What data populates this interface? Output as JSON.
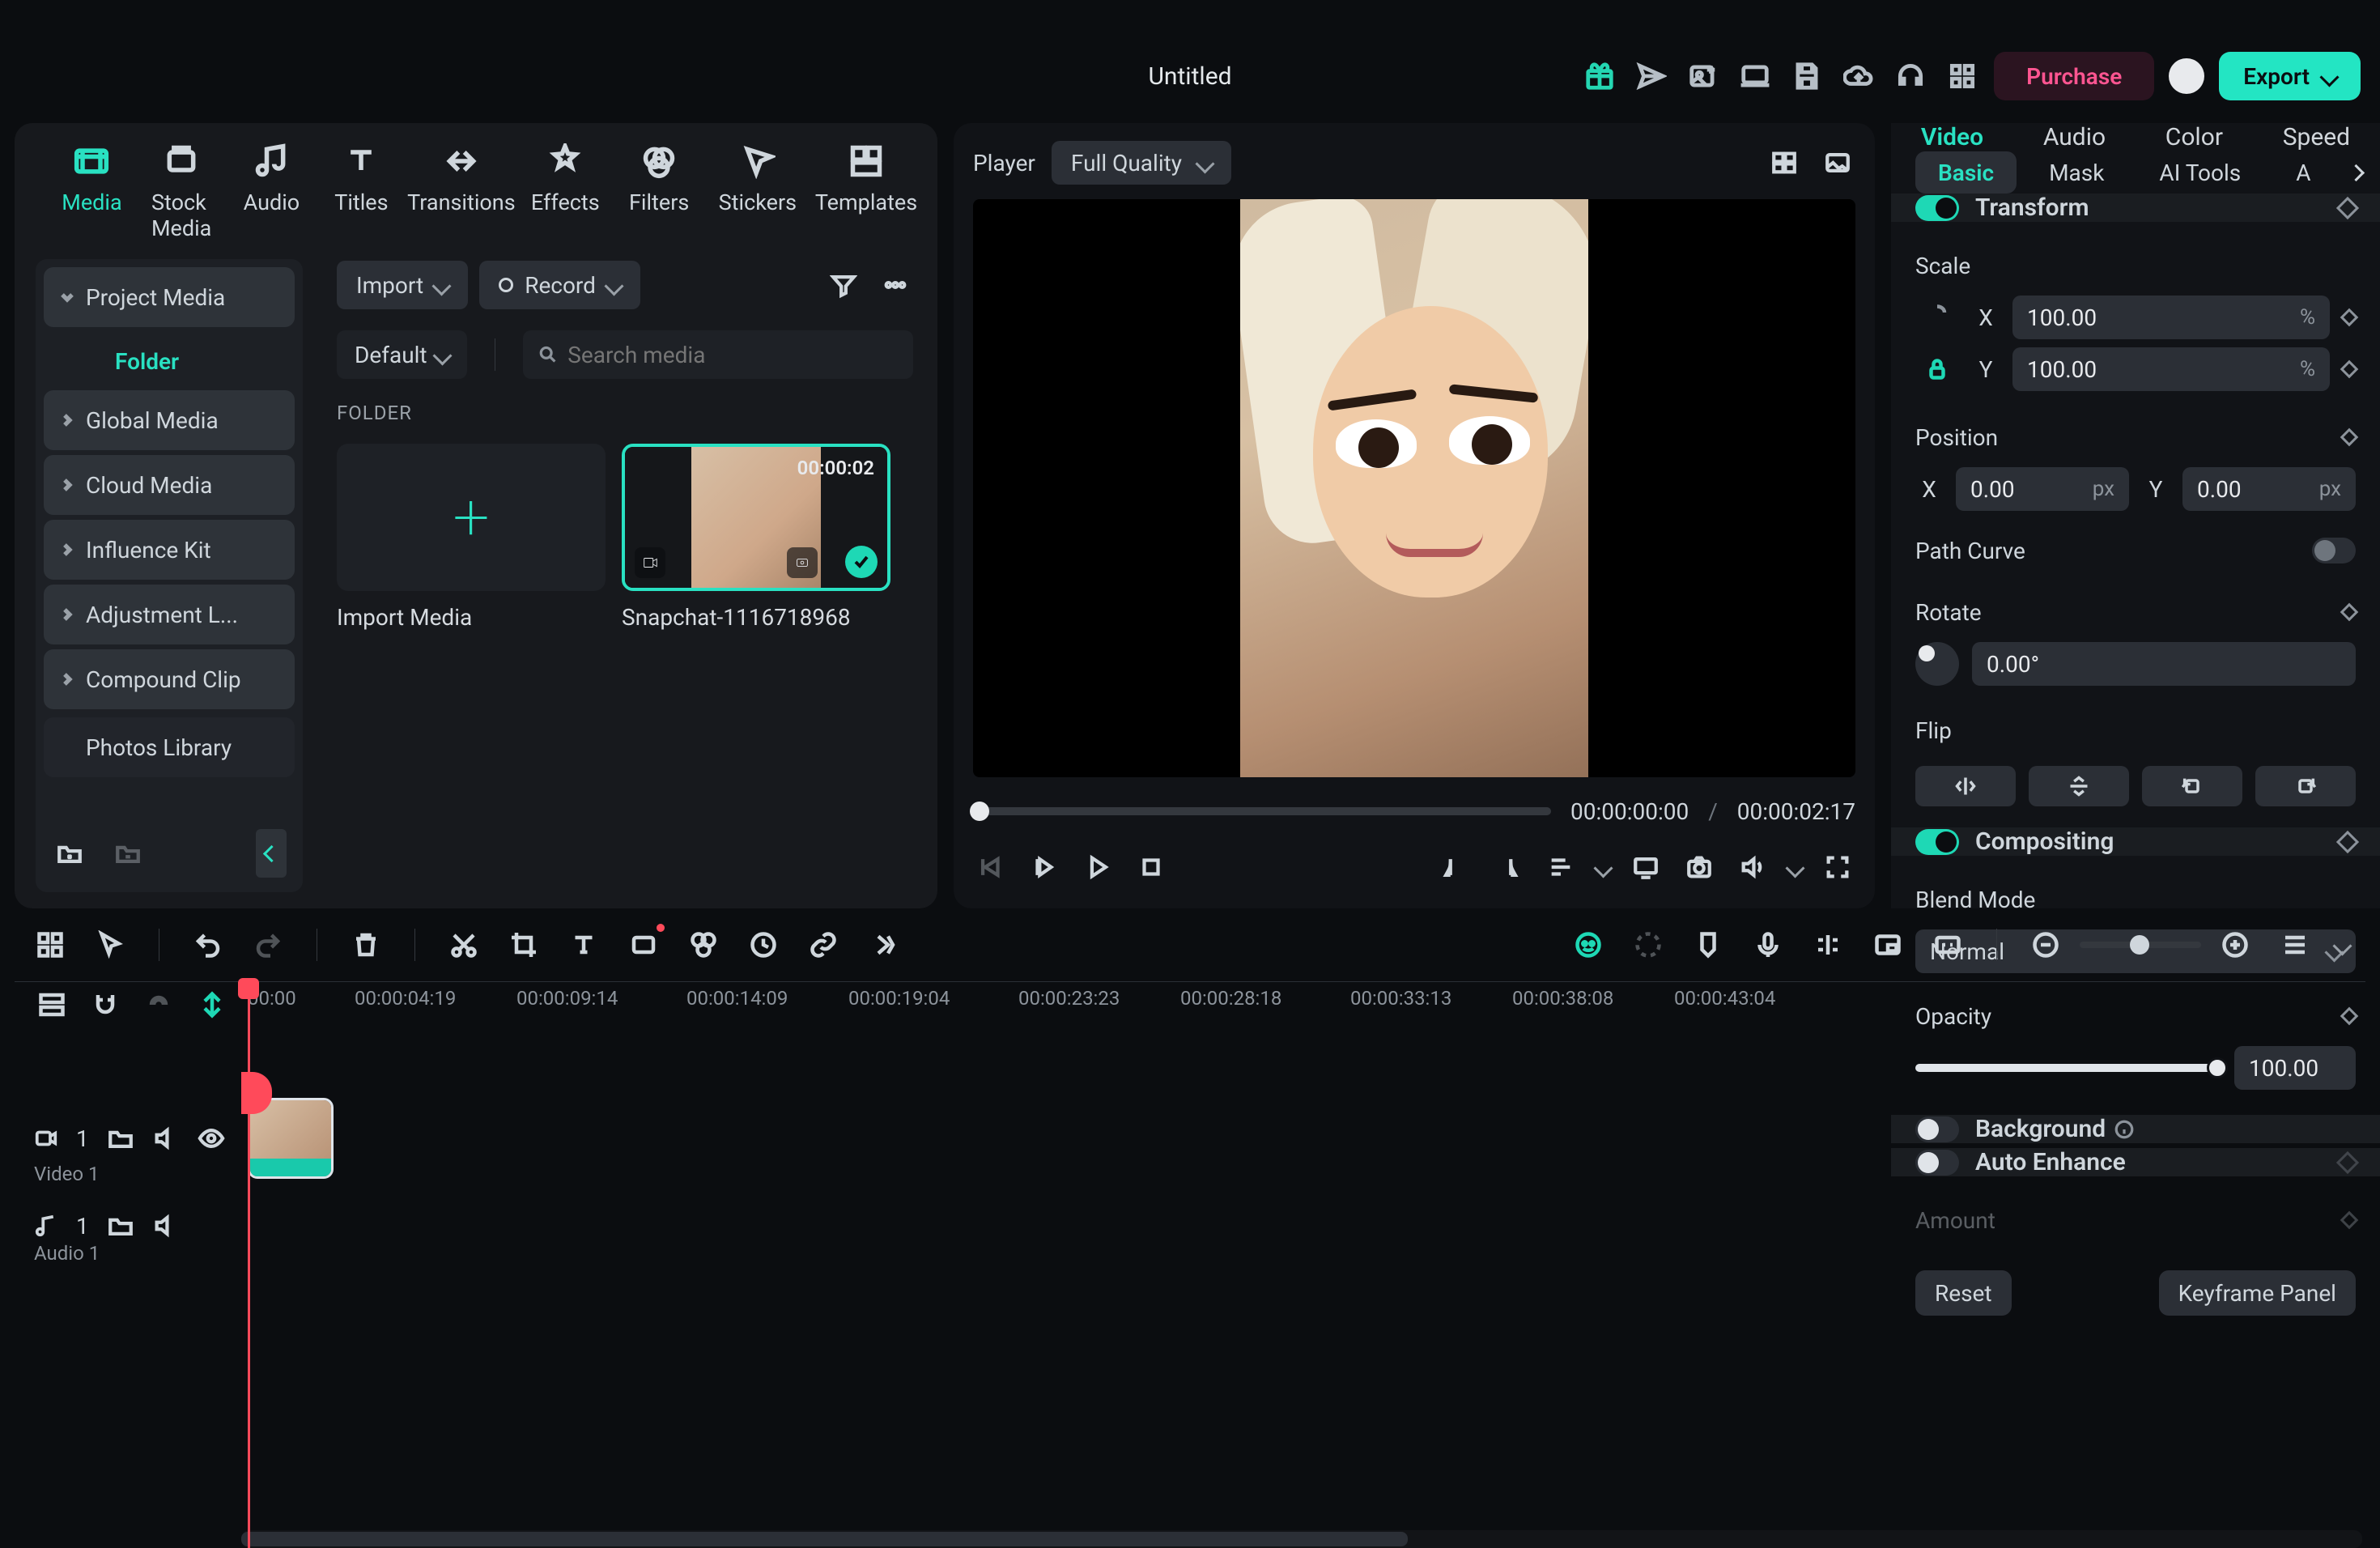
{
  "title": "Untitled",
  "topIcons": [
    "gift-icon",
    "send-icon",
    "image-add-icon",
    "device-icon",
    "save-icon",
    "cloud-upload-icon",
    "headset-icon",
    "grid-icon"
  ],
  "purchase": "Purchase",
  "export": "Export",
  "categories": [
    {
      "name": "media",
      "label": "Media",
      "active": true
    },
    {
      "name": "stock-media",
      "label": "Stock Media"
    },
    {
      "name": "audio",
      "label": "Audio"
    },
    {
      "name": "titles",
      "label": "Titles"
    },
    {
      "name": "transitions",
      "label": "Transitions"
    },
    {
      "name": "effects",
      "label": "Effects"
    },
    {
      "name": "filters",
      "label": "Filters"
    },
    {
      "name": "stickers",
      "label": "Stickers"
    },
    {
      "name": "templates",
      "label": "Templates"
    }
  ],
  "sidebar": {
    "items": [
      {
        "label": "Project Media",
        "expanded": true,
        "bg": true,
        "sub": "Folder"
      },
      {
        "label": "Global Media"
      },
      {
        "label": "Cloud Media"
      },
      {
        "label": "Influence Kit"
      },
      {
        "label": "Adjustment L..."
      },
      {
        "label": "Compound Clip"
      },
      {
        "label": "Photos Library",
        "flat": true
      }
    ]
  },
  "mediaToolbar": {
    "import": "Import",
    "record": "Record",
    "sort": "Default",
    "searchPlaceholder": "Search media"
  },
  "folderLabel": "FOLDER",
  "tiles": {
    "importLabel": "Import Media",
    "clip": {
      "duration": "00:00:02",
      "name": "Snapchat-1116718968"
    }
  },
  "player": {
    "label": "Player",
    "quality": "Full Quality",
    "current": "00:00:00:00",
    "sep": "/",
    "total": "00:00:02:17"
  },
  "inspector": {
    "tabs": [
      "Video",
      "Audio",
      "Color",
      "Speed"
    ],
    "activeTab": 0,
    "subtabs": [
      "Basic",
      "Mask",
      "AI Tools",
      "A"
    ],
    "activeSubtab": 0,
    "transform": {
      "title": "Transform",
      "scaleLabel": "Scale",
      "scaleX": "100.00",
      "scaleY": "100.00",
      "scaleUnit": "%",
      "positionLabel": "Position",
      "posX": "0.00",
      "posY": "0.00",
      "posUnit": "px",
      "pathCurveLabel": "Path Curve",
      "pathCurveOn": false,
      "rotateLabel": "Rotate",
      "rotate": "0.00°",
      "flipLabel": "Flip"
    },
    "compositing": {
      "title": "Compositing",
      "blendLabel": "Blend Mode",
      "blendValue": "Normal",
      "opacityLabel": "Opacity",
      "opacityValue": "100.00"
    },
    "background": {
      "title": "Background"
    },
    "autoEnhance": {
      "title": "Auto Enhance",
      "amountLabel": "Amount"
    },
    "reset": "Reset",
    "keyframe": "Keyframe Panel"
  },
  "timeline": {
    "ruler": [
      "00:00",
      "00:00:04:19",
      "00:00:09:14",
      "00:00:14:09",
      "00:00:19:04",
      "00:00:23:23",
      "00:00:28:18",
      "00:00:33:13",
      "00:00:38:08",
      "00:00:43:04"
    ],
    "video": {
      "label": "Video 1",
      "index": "1"
    },
    "audio": {
      "label": "Audio 1",
      "index": "1"
    }
  }
}
